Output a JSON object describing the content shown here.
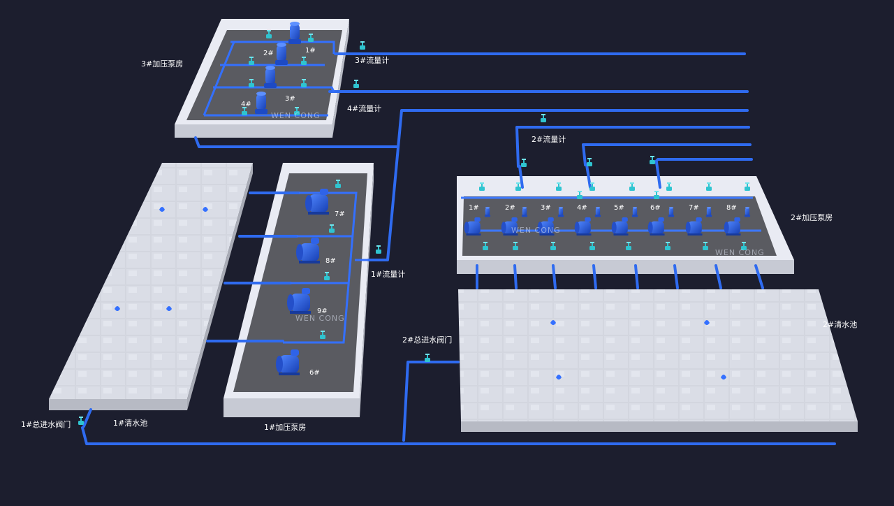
{
  "colors": {
    "background": "#1c1e2e",
    "pipe": "#2f6bf0",
    "pipe_highlight": "#6f9bff",
    "pump": "#1f54d6",
    "valve": "#2fc4d0",
    "room_wall": "#e6e8f2",
    "room_floor": "#595a60",
    "pool": "#d6d9e2"
  },
  "labels": {
    "pump_room_3": "3#加压泵房",
    "pump_room_2": "2#加压泵房",
    "pump_room_1": "1#加压泵房",
    "flowmeter_1": "1#流量计",
    "flowmeter_2": "2#流量计",
    "flowmeter_3": "3#流量计",
    "flowmeter_4": "4#流量计",
    "clear_pool_1": "1#清水池",
    "clear_pool_2": "2#清水池",
    "main_valve_1": "1#总进水阀门",
    "main_valve_2": "2#总进水阀门"
  },
  "watermark": "WEN CONG",
  "pumps": {
    "room_3": [
      "1#",
      "2#",
      "3#",
      "4#"
    ],
    "room_1": [
      "7#",
      "8#",
      "9#",
      "6#"
    ],
    "room_2": [
      "1#",
      "2#",
      "3#",
      "4#",
      "5#",
      "6#",
      "7#",
      "8#"
    ]
  },
  "icons": {
    "pump": "centrifugal-pump-icon",
    "valve": "gate-valve-icon",
    "flowmeter": "flowmeter-icon",
    "inlet": "water-inlet-icon"
  }
}
